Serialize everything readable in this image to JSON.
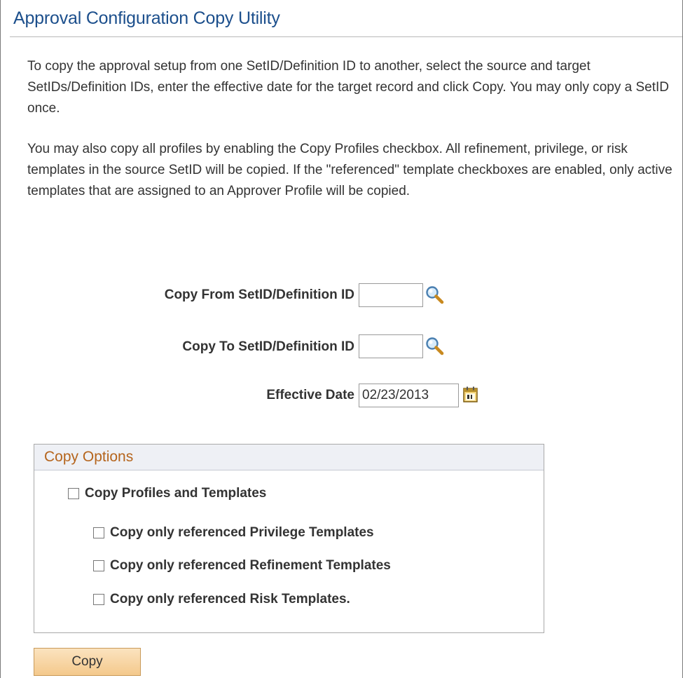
{
  "page": {
    "title": "Approval Configuration Copy Utility"
  },
  "instructions": {
    "p1": "To copy the approval setup from one SetID/Definition ID to another, select the source and target SetIDs/Definition IDs, enter the effective date for the target record and click Copy. You may only copy a SetID once.",
    "p2": "You may also copy all profiles by enabling the Copy Profiles checkbox. All refinement, privilege, or risk templates in the source SetID will be copied. If the \"referenced\" template checkboxes are enabled, only active templates that are assigned to an Approver Profile will be copied."
  },
  "form": {
    "copy_from": {
      "label": "Copy From SetID/Definition ID",
      "value": ""
    },
    "copy_to": {
      "label": "Copy To SetID/Definition ID",
      "value": ""
    },
    "effective_date": {
      "label": "Effective Date",
      "value": "02/23/2013"
    }
  },
  "copy_options": {
    "header": "Copy Options",
    "profiles": {
      "label": "Copy Profiles and Templates",
      "checked": false
    },
    "privilege": {
      "label": "Copy only referenced Privilege Templates",
      "checked": false
    },
    "refinement": {
      "label": "Copy only referenced Refinement Templates",
      "checked": false
    },
    "risk": {
      "label": "Copy only referenced Risk Templates.",
      "checked": false
    }
  },
  "actions": {
    "copy_label": "Copy"
  },
  "icons": {
    "lookup": "magnifier-icon",
    "calendar": "calendar-icon"
  }
}
